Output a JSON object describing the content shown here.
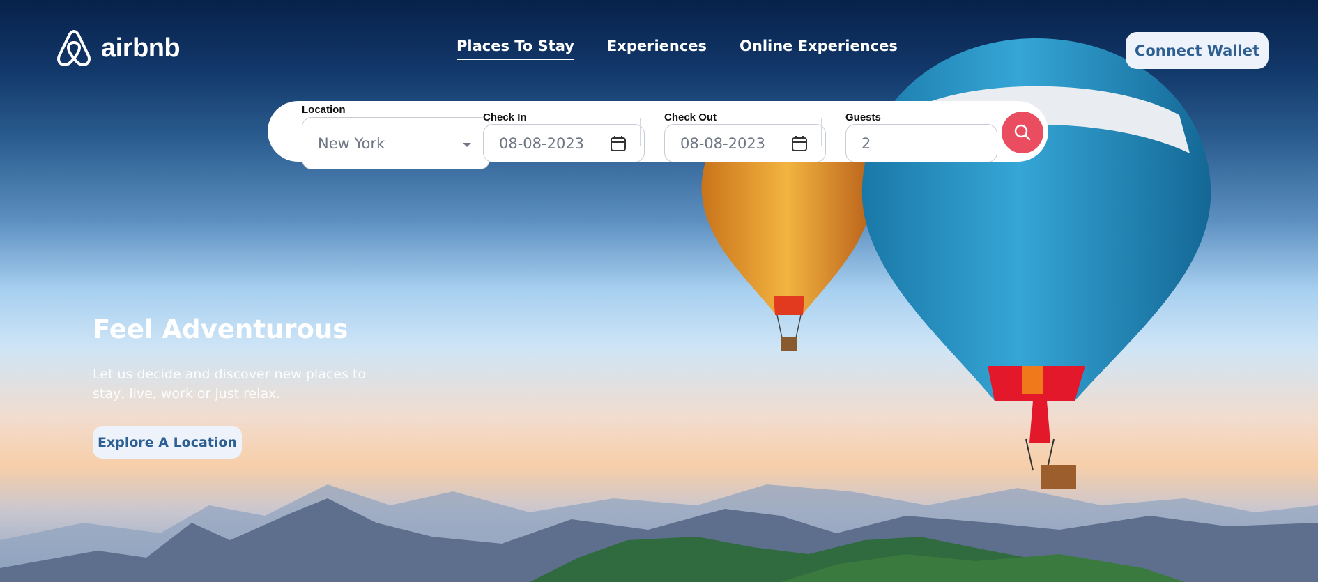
{
  "brand": {
    "name": "airbnb",
    "icon": "airbnb-logo-icon"
  },
  "nav": {
    "items": [
      {
        "label": "Places To Stay",
        "active": true
      },
      {
        "label": "Experiences",
        "active": false
      },
      {
        "label": "Online Experiences",
        "active": false
      }
    ]
  },
  "header": {
    "wallet_label": "Connect Wallet"
  },
  "search": {
    "location": {
      "label": "Location",
      "value": "New York",
      "icon": "chevron-down-icon"
    },
    "check_in": {
      "label": "Check In",
      "value": "08-08-2023",
      "icon": "calendar-icon"
    },
    "check_out": {
      "label": "Check Out",
      "value": "08-08-2023",
      "icon": "calendar-icon"
    },
    "guests": {
      "label": "Guests",
      "value": "2"
    },
    "button_icon": "search-icon"
  },
  "hero": {
    "headline": "Feel Adventurous",
    "subtext": "Let us decide and discover new places to stay, live, work or just relax.",
    "cta_label": "Explore A Location"
  },
  "colors": {
    "accent": "#EA4D5F",
    "button_bg": "#EEF3FB",
    "button_text": "#2D5F93"
  }
}
